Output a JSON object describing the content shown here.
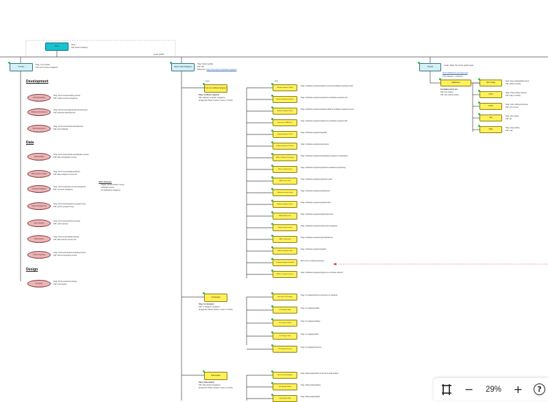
{
  "diagram": {
    "top_node": {
      "label": "Home",
      "note_line1": "Slug: /",
      "note_line2": "KW: Rustic Academy",
      "edge_label": "career guides"
    },
    "courses": {
      "label": "Courses",
      "note_line1": "Slug: /my-courses",
      "note_line2": "KW: tech courses singapore",
      "sections": [
        {
          "title": "Development",
          "items": [
            {
              "label": "Coding Bootcamp",
              "note_line1": "Slug: /tech-courses/coding-course",
              "note_line2": "KW: coding courses singapore"
            },
            {
              "label": "Software Development",
              "note_line1": "Slug: /tech-courses/javascript-development",
              "note_line2": "KW: javascript development"
            },
            {
              "label": "Web Development",
              "note_line1": "Slug: /tech-courses/web-development",
              "note_line2": "KW: learn fullstack"
            }
          ]
        },
        {
          "title": "Data",
          "items": [
            {
              "label": "Data Analytics",
              "note_line1": "Slug: /tech-courses/data-visualisation-course",
              "note_line2": "KW: data visualisation course"
            },
            {
              "label": "Data Analytics Course",
              "note_line1": "Slug: /tech-courses/data-analytics",
              "note_line2": "KW: data analytics course SG"
            },
            {
              "label": "AI Course Singapore",
              "note_line1": "Slug: /tech-courses/ai-courses-singapore",
              "note_line2": "KW: ai course singapore"
            },
            {
              "label": "Python Programming",
              "note_line1": "Slug: /tech-courses/python-programming",
              "note_line2": "KW: python programming"
            },
            {
              "label": "Cyber Security",
              "note_line1": "Slug: /tech-courses/cyber-security",
              "note_line2": "KW: cyber security"
            },
            {
              "label": "Data Science",
              "note_line1": "Slug: /tech-courses/data-science",
              "note_line2": "KW: data science course SG"
            },
            {
              "label": "Cloud Computing",
              "note_line1": "Slug: /www.amazonaws.shopping-course",
              "note_line2": "KW: Cloud Computing course"
            }
          ]
        },
        {
          "title": "Design",
          "items": [
            {
              "label": "UX Design",
              "note_line1": "Slug: /tech-courses/ux-design",
              "note_line2": "KW: ux/ui design"
            }
          ]
        }
      ],
      "other_schemes": {
        "title": "Other Schemes",
        "lines": [
          "Digital Transformation course",
          "ChatGPT course",
          "AI certification singapore"
        ]
      }
    },
    "career_guides": {
      "label": "Career Guide Singapore",
      "note_line1": "Slug: /career-guides",
      "note_line2": "KW: N/A",
      "note_line3_label": "Reference:",
      "note_line3_link": "https://incomely.com/guides-singapore",
      "col_core": "Core",
      "col_sub": "Sub",
      "software": {
        "label": "How to be Software Engineer",
        "note_title": "Slug: /software-engineer",
        "note_line2": "KW: software engineer singapore",
        "note_line3": "[Image Ref: Book, Section: Learn it, Finish]",
        "subs": [
          {
            "label": "Software Engineer Salary",
            "note": "Slug: /software-engineering/how-much-do-software-engineers-earn"
          },
          {
            "label": "Software Engineering Roles",
            "note": "Slug: /software-engineering/what-do-software-engineers-do"
          },
          {
            "label": "Software Engineer Skills",
            "note": "Slug: /software-engineering/what-skills-do-software-engineers-need"
          },
          {
            "label": "How to be a SWE Fast",
            "note": "Slug: /software-engineering/become-software-engineer-fast"
          },
          {
            "label": "Software Engineer Tasks",
            "note": "Slug: /software-engineering/skills"
          },
          {
            "label": "Software Engineer Resume",
            "note": "Slug: /software-engineering/resume"
          },
          {
            "label": "SWE vs Software Developer",
            "note": "Slug: /software-engineering/software-engineer-vs-developer"
          },
          {
            "label": "What is Software Eng",
            "note": "Slug: /software-engineering/what-is-software-engineering"
          },
          {
            "label": "SWE Career Path",
            "note": "Slug: /software-engineering/career-path"
          },
          {
            "label": "Software Interview Guide",
            "note": "Slug: /software-engineering/interview"
          },
          {
            "label": "Software Engineer Intern",
            "note": "Slug: /software-engineering/internship"
          },
          {
            "label": "SWE Requirements",
            "note": "Slug: /software-engineering/requirements"
          },
          {
            "label": "Software Eng Courses",
            "note": "Slug: /software-engineering/courses-singapore"
          },
          {
            "label": "SWE Certifications",
            "note": "Slug: /software-engineering/certifications"
          },
          {
            "label": "Software Engineer Jobs",
            "note": "Slug: /software-engineering/jobs"
          },
          {
            "label": "Is Software Engineering Hard",
            "note": "Mirror from /coding-bootcamp"
          },
          {
            "label": "SWE vs Computer Science",
            "note": "Slug: /software-engineering/swe-vs-computer-science"
          }
        ]
      },
      "ux": {
        "label": "UX Designer",
        "note_title": "Slug: /ux-designer",
        "note_line2": "KW: ux designer singapore",
        "note_line3": "[Image Ref: Book, Section: Learn it, Finish]",
        "subs": [
          {
            "label": "How to be UX Designer",
            "note": "Slug: /ux-designer/how-to-become-ux-designer"
          },
          {
            "label": "UX Designer Skills",
            "note": "Slug: /ux-designer/skills"
          },
          {
            "label": "UX Designer Salary",
            "note": "Slug: /ux-designer/salary"
          },
          {
            "label": "UX Designer Jobs",
            "note": "Slug: /ux-designer/jobs"
          },
          {
            "label": "UX Designer Resume",
            "note": "Slug: /ux-designer/resume"
          }
        ]
      },
      "data": {
        "label": "Data Analyst",
        "note_title": "Slug: /data-analyst",
        "note_line2": "KW: data analyst singapore",
        "note_line3": "[Image Ref: Book, Section: Learn it, Finish]",
        "subs": [
          {
            "label": "How to be Data Analyst",
            "note": "Slug: /data-analyst/how-to-become-data-analyst"
          },
          {
            "label": "Data Analyst Salary",
            "note": "Slug: /data-analyst/salary"
          },
          {
            "label": "Data Analyst Skills",
            "note": "Slug: /data-analyst/skills"
          }
        ]
      }
    },
    "funded": {
      "label": "Funded",
      "note": "Goals - Make this career guides page",
      "link": "https://skillsfuture.gov.sg/ecredit",
      "category_label": "TSS Category - possesss",
      "sub": {
        "label": "SkillsFuture",
        "note_title": "Fundablecredit Link",
        "note_line2": "KW: free coding",
        "note_line3": "KW: free coding course"
      },
      "children": [
        {
          "label": "SFC Coding",
          "note_line1": "Slug: /free-coding/skills-future",
          "note_line2": "KW: what is coding"
        },
        {
          "label": "UTAP",
          "note_line1": "Slug: /utap-coding-courses",
          "note_line2": "KW: utap in coding"
        },
        {
          "label": "SCTP",
          "note_line1": "Slug: /sctp-coding-bootcamp",
          "note_line2": "KW: sctp course"
        },
        {
          "label": "SFC",
          "note_line1": "Slug: /sfc-coding",
          "note_line2": "KW: sfc"
        },
        {
          "label": "WSG",
          "note_line1": "Slug: /wsg-coding",
          "note_line2": "KW: wsg"
        }
      ]
    }
  },
  "toolbar": {
    "fit_icon": "fit-to-screen-icon",
    "zoom_out_glyph": "−",
    "zoom_level": "29%",
    "zoom_in_glyph": "+",
    "help_glyph": "?"
  }
}
